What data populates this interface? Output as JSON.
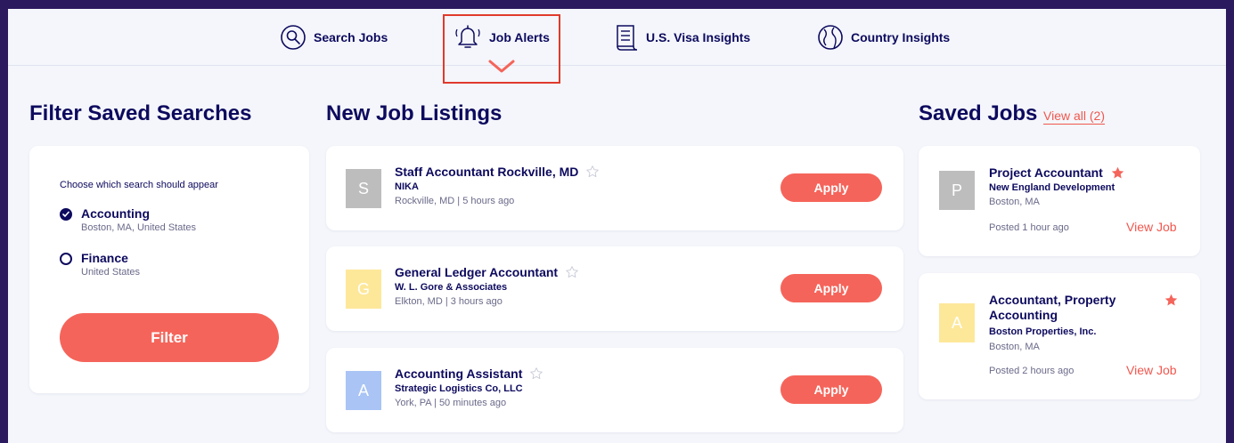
{
  "nav": {
    "items": [
      {
        "label": "Search Jobs",
        "icon": "search-icon"
      },
      {
        "label": "Job Alerts",
        "icon": "bell-icon"
      },
      {
        "label": "U.S. Visa Insights",
        "icon": "document-icon"
      },
      {
        "label": "Country Insights",
        "icon": "globe-icon"
      }
    ],
    "active": "Job Alerts"
  },
  "filter": {
    "title": "Filter Saved Searches",
    "prompt": "Choose which search should appear",
    "options": [
      {
        "label": "Accounting",
        "sub": "Boston, MA, United States",
        "checked": true
      },
      {
        "label": "Finance",
        "sub": "United States",
        "checked": false
      }
    ],
    "button": "Filter"
  },
  "listings": {
    "title": "New Job Listings",
    "apply_label": "Apply",
    "jobs": [
      {
        "initial": "S",
        "title": "Staff Accountant Rockville, MD",
        "company": "NIKA",
        "meta": "Rockville, MD | 5 hours ago",
        "avatar_color": "#bdbdbd"
      },
      {
        "initial": "G",
        "title": "General Ledger Accountant",
        "company": "W. L. Gore & Associates",
        "meta": "Elkton, MD | 3 hours ago",
        "avatar_color": "#fde89a"
      },
      {
        "initial": "A",
        "title": "Accounting Assistant",
        "company": "Strategic Logistics Co, LLC",
        "meta": "York, PA | 50 minutes ago",
        "avatar_color": "#a9c4f5"
      }
    ]
  },
  "saved": {
    "title": "Saved Jobs",
    "view_all": "View all (2)",
    "view_job_label": "View Job",
    "jobs": [
      {
        "initial": "P",
        "title": "Project Accountant",
        "company": "New England Development",
        "location": "Boston, MA",
        "posted": "Posted 1 hour ago",
        "avatar_color": "#bdbdbd"
      },
      {
        "initial": "A",
        "title": "Accountant, Property Accounting",
        "company": "Boston Properties, Inc.",
        "location": "Boston, MA",
        "posted": "Posted 2 hours ago",
        "avatar_color": "#fde89a"
      }
    ]
  },
  "colors": {
    "navy": "#0d0a5e",
    "coral": "#f5645a",
    "highlight": "#e03a2c",
    "frame": "#2c1a5e"
  }
}
